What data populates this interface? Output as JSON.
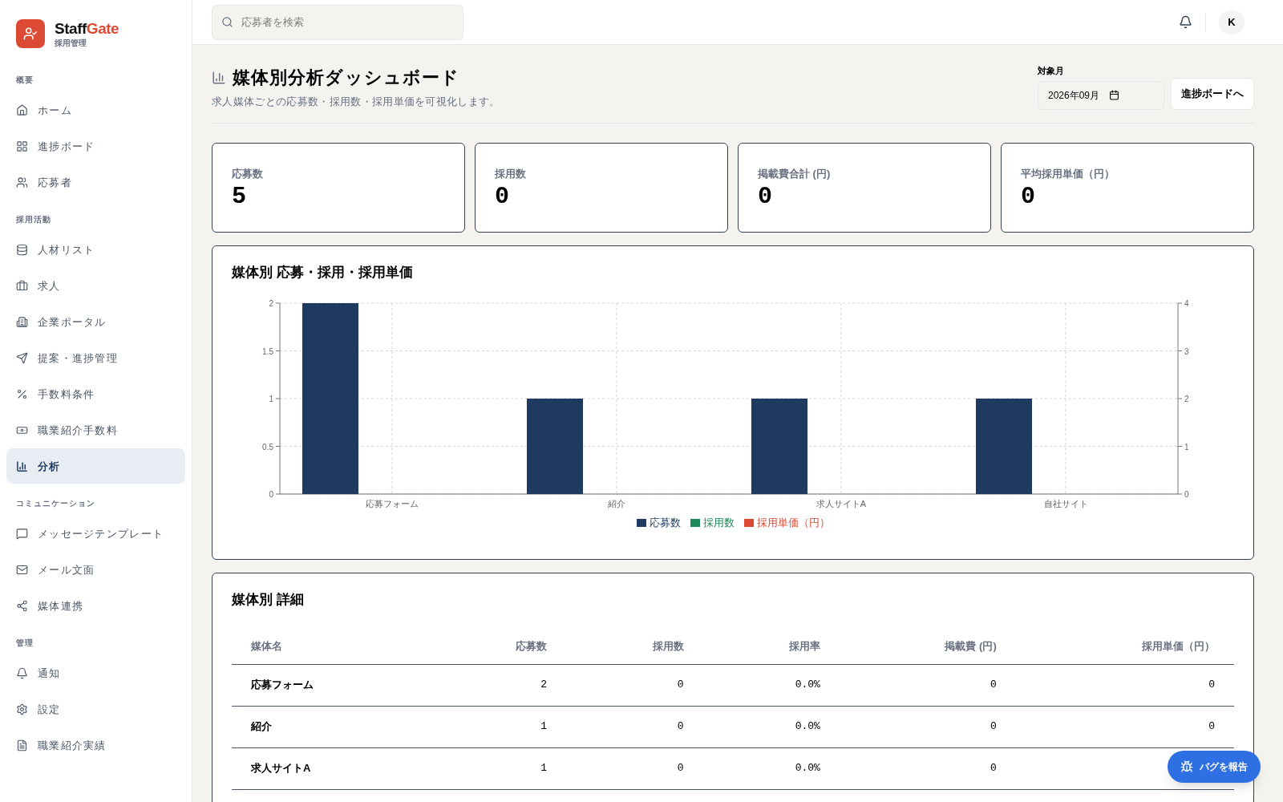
{
  "brand": {
    "name_a": "Staff",
    "name_b": "Gate",
    "subtitle": "採用管理"
  },
  "sidebar": {
    "sections": [
      {
        "title": "概要",
        "items": [
          {
            "label": "ホーム",
            "selected": false
          },
          {
            "label": "進捗ボード",
            "selected": false
          },
          {
            "label": "応募者",
            "selected": false
          }
        ]
      },
      {
        "title": "採用活動",
        "items": [
          {
            "label": "人材リスト",
            "selected": false
          },
          {
            "label": "求人",
            "selected": false
          },
          {
            "label": "企業ポータル",
            "selected": false
          },
          {
            "label": "提案・進捗管理",
            "selected": false
          },
          {
            "label": "手数料条件",
            "selected": false
          },
          {
            "label": "職業紹介手数料",
            "selected": false
          },
          {
            "label": "分析",
            "selected": true
          }
        ]
      },
      {
        "title": "コミュニケーション",
        "items": [
          {
            "label": "メッセージテンプレート",
            "selected": false
          },
          {
            "label": "メール文面",
            "selected": false
          },
          {
            "label": "媒体連携",
            "selected": false
          }
        ]
      },
      {
        "title": "管理",
        "items": [
          {
            "label": "通知",
            "selected": false
          },
          {
            "label": "設定",
            "selected": false
          },
          {
            "label": "職業紹介実績",
            "selected": false
          }
        ]
      }
    ]
  },
  "topbar": {
    "search": {
      "placeholder": "応募者を検索"
    },
    "avatar": "K"
  },
  "page": {
    "title": "媒体別分析ダッシュボード",
    "subtitle": "求人媒体ごとの応募数・採用数・採用単価を可視化します。",
    "month_label": "対象月",
    "month_value": "2026年09月",
    "board_button": "進捗ボードへ"
  },
  "stats": [
    {
      "label": "応募数",
      "value": "5"
    },
    {
      "label": "採用数",
      "value": "0"
    },
    {
      "label": "掲載費合計 (円)",
      "value": "0"
    },
    {
      "label": "平均採用単価（円）",
      "value": "0"
    }
  ],
  "chart_card": {
    "title": "媒体別 応募・採用・採用単価",
    "chart_data": {
      "type": "bar",
      "categories": [
        "応募フォーム",
        "紹介",
        "求人サイトA",
        "自社サイト"
      ],
      "series": [
        {
          "name": "応募数",
          "color": "#1f3a5f",
          "values": [
            2,
            1,
            1,
            1
          ]
        },
        {
          "name": "採用数",
          "color": "#1e8a5a",
          "values": [
            0,
            0,
            0,
            0
          ]
        },
        {
          "name": "採用単価（円）",
          "color": "#dc4a33",
          "values": [
            0,
            0,
            0,
            0
          ]
        }
      ],
      "ylim": [
        0,
        2
      ],
      "yticks": [
        0,
        {
          "value": 0.5,
          "label": "0.5"
        },
        1,
        {
          "value": 1.5,
          "label": "1.5"
        },
        2
      ],
      "grid": true
    },
    "right_axis_ticks": [
      "4",
      "3",
      "2",
      "1",
      "0"
    ]
  },
  "table_card": {
    "title": "媒体別 詳細",
    "columns": [
      "媒体名",
      "応募数",
      "採用数",
      "採用率",
      "掲載費 (円)",
      "採用単価（円）"
    ],
    "rows": [
      {
        "cells": [
          "応募フォーム",
          "2",
          "0",
          "0.0%",
          "0",
          "0"
        ]
      },
      {
        "cells": [
          "紹介",
          "1",
          "0",
          "0.0%",
          "0",
          "0"
        ]
      },
      {
        "cells": [
          "求人サイトA",
          "1",
          "0",
          "0.0%",
          "0"
        ]
      }
    ]
  },
  "report_button": "バグを報告"
}
